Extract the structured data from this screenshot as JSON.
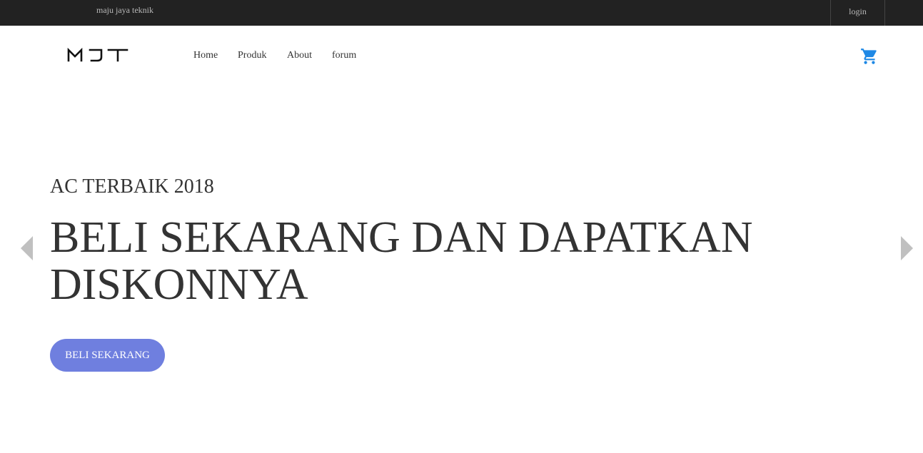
{
  "topbar": {
    "site_name": "maju jaya teknik",
    "login_label": "login"
  },
  "navbar": {
    "logo_text": "MJT",
    "links": [
      {
        "label": "Home"
      },
      {
        "label": "Produk"
      },
      {
        "label": "About"
      },
      {
        "label": "forum"
      }
    ],
    "cart_icon": "cart-icon",
    "cart_color": "#1e88e5"
  },
  "hero": {
    "subtitle": "AC TERBAIK 2018",
    "title": "BELI SEKARANG DAN DAPATKAN DISKONNYA",
    "cta_label": "BELI SEKARANG",
    "cta_color": "#6f7fdf",
    "prev_icon": "chevron-left-icon",
    "next_icon": "chevron-right-icon"
  }
}
